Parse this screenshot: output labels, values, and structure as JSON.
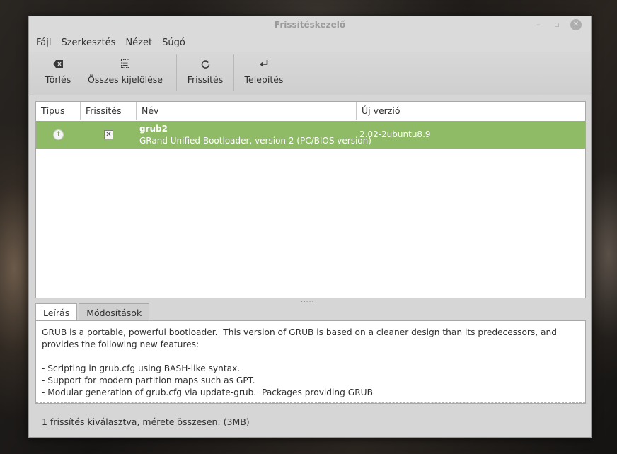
{
  "window": {
    "title": "Frissítéskezelő",
    "controls": {
      "minimize": "–",
      "maximize": "▫",
      "close": "✕"
    }
  },
  "menubar": {
    "items": [
      "Fájl",
      "Szerkesztés",
      "Nézet",
      "Súgó"
    ]
  },
  "toolbar": {
    "clear_label": "Törlés",
    "select_all_label": "Összes kijelölése",
    "refresh_label": "Frissítés",
    "install_label": "Telepítés"
  },
  "list": {
    "columns": [
      "Típus",
      "Frissítés",
      "Név",
      "Új verzió"
    ],
    "rows": [
      {
        "type_icon": "upgrade-arrow-icon",
        "checked": true,
        "name": "grub2",
        "description": "GRand Unified Bootloader, version 2 (PC/BIOS version)",
        "new_version": "2.02-2ubuntu8.9",
        "selected_color": "#8fbb67"
      }
    ]
  },
  "tabs": {
    "description_label": "Leírás",
    "changes_label": "Módosítások",
    "active": "Leírás"
  },
  "description": {
    "text": "GRUB is a portable, powerful bootloader.  This version of GRUB is based on a cleaner design than its predecessors, and provides the following new features:\n\n- Scripting in grub.cfg using BASH-like syntax.\n- Support for modern partition maps such as GPT.\n- Modular generation of grub.cfg via update-grub.  Packages providing GRUB"
  },
  "status": {
    "text": "1 frissítés kiválasztva, mérete összesen: (3MB)"
  },
  "colors": {
    "selection": "#8fbb67",
    "window_bg": "#d6d6d6"
  }
}
